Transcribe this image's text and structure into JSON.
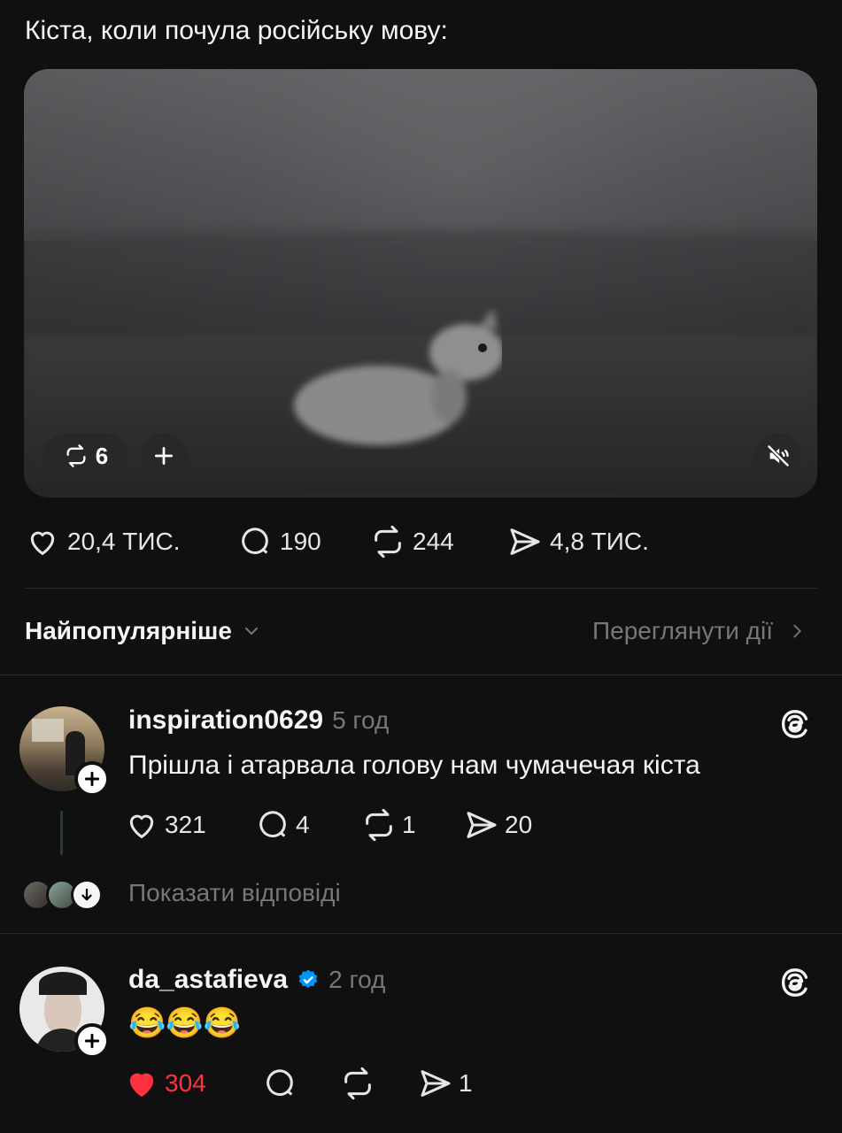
{
  "post": {
    "text": "Кіста, коли почула російську мову:",
    "video": {
      "repost_count": "6",
      "muted": true
    },
    "stats": {
      "likes": "20,4 ТИС.",
      "comments": "190",
      "reposts": "244",
      "shares": "4,8 ТИС."
    }
  },
  "sort": {
    "label": "Найпопулярніше",
    "activity_label": "Переглянути дії"
  },
  "comments": [
    {
      "username": "inspiration0629",
      "time": "5 год",
      "text": "Прішла і атарвала голову нам чумачечая кіста",
      "likes": "321",
      "replies": "4",
      "reposts": "1",
      "shares": "20",
      "show_replies_label": "Показати відповіді"
    },
    {
      "username": "da_astafieva",
      "verified": true,
      "time": "2 год",
      "text": "😂😂😂",
      "likes": "304",
      "liked": true,
      "shares": "1"
    }
  ],
  "colors": {
    "background": "#101010",
    "text": "#f3f5f7",
    "muted": "#777777",
    "like": "#ff3040",
    "verified": "#0095f6"
  }
}
